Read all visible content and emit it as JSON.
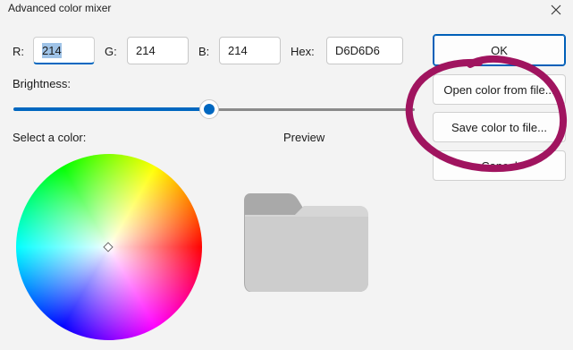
{
  "window": {
    "title": "Advanced color mixer"
  },
  "fields": {
    "r_label": "R:",
    "r_value": "214",
    "g_label": "G:",
    "g_value": "214",
    "b_label": "B:",
    "b_value": "214",
    "hex_label": "Hex:",
    "hex_value": "D6D6D6"
  },
  "brightness": {
    "label": "Brightness:",
    "level_percent": 47
  },
  "picker": {
    "select_label": "Select a color:",
    "preview_label": "Preview",
    "preview_color": "#D6D6D6"
  },
  "buttons": {
    "ok": "OK",
    "open": "Open color from file...",
    "save": "Save color to file...",
    "cancel": "Cancel"
  },
  "colors": {
    "accent": "#0067C0",
    "annotation": "#A0145F"
  },
  "icons": {
    "close": "close-icon",
    "preview": "folder-icon"
  }
}
